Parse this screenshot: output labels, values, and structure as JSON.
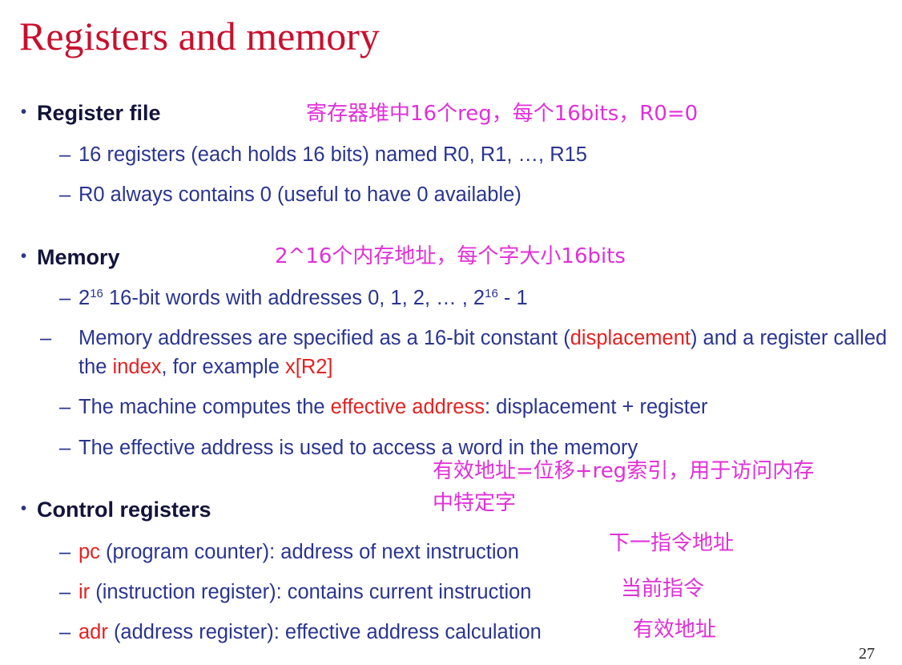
{
  "title": "Registers and memory",
  "page_number": "27",
  "colors": {
    "title": "#c8102e",
    "heading": "#12143a",
    "body": "#2a3590",
    "highlight": "#e32222",
    "annotation": "#e030d8"
  },
  "sections": [
    {
      "heading": "Register file",
      "annotation": "寄存器堆中16个reg，每个16bits，R0=0",
      "items": [
        {
          "text": "16 registers (each holds 16 bits) named R0, R1, …, R15"
        },
        {
          "text": "R0 always contains 0 (useful to have 0 available)"
        }
      ]
    },
    {
      "heading": "Memory",
      "annotation": "2^16个内存地址，每个字大小16bits",
      "items": [
        {
          "base_1": "2",
          "exp_1": "16",
          "middle": " 16-bit words with addresses 0, 1, 2, … , ",
          "base_2": "2",
          "exp_2": "16",
          "end": " - 1"
        },
        {
          "part_1": "Memory addresses are specified as a 16-bit constant (",
          "hl_1": "displacement",
          "part_2": ") and a register called the ",
          "hl_2": "index",
          "part_3": ", for example ",
          "hl_3": "x[R2]"
        },
        {
          "part_1": "The machine computes the ",
          "hl_1": "effective address",
          "part_2": ": displacement + register"
        },
        {
          "text": "The effective address is used to access a word in the memory"
        }
      ],
      "annotation_2": [
        "有效地址=位移+reg索引，用于访问内存",
        "中特定字"
      ]
    },
    {
      "heading": "Control registers",
      "items": [
        {
          "name": "pc",
          "desc": " (program counter): address of next instruction",
          "annotation": "下一指令地址"
        },
        {
          "name": "ir",
          "desc": " (instruction register): contains current instruction",
          "annotation": "当前指令"
        },
        {
          "name": "adr",
          "desc": " (address register): effective address calculation",
          "annotation": "有效地址"
        }
      ]
    }
  ]
}
